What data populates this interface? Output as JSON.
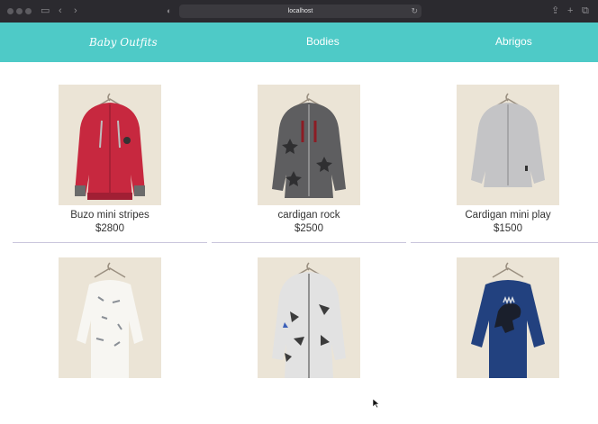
{
  "browser": {
    "address": "localhost"
  },
  "nav": {
    "brand": "Baby Outfits",
    "links": [
      "Bodies",
      "Abrigos"
    ],
    "background": "#4ecac7"
  },
  "products": [
    {
      "name": "Buzo mini stripes",
      "price": "$2800",
      "garment": "red-hoodie"
    },
    {
      "name": "cardigan rock",
      "price": "$2500",
      "garment": "grey-star-hoodie"
    },
    {
      "name": "Cardigan mini play",
      "price": "$1500",
      "garment": "light-grey-hoodie"
    },
    {
      "garment": "white-bodysuit"
    },
    {
      "garment": "white-print-jacket"
    },
    {
      "garment": "navy-dino-bodysuit"
    }
  ]
}
